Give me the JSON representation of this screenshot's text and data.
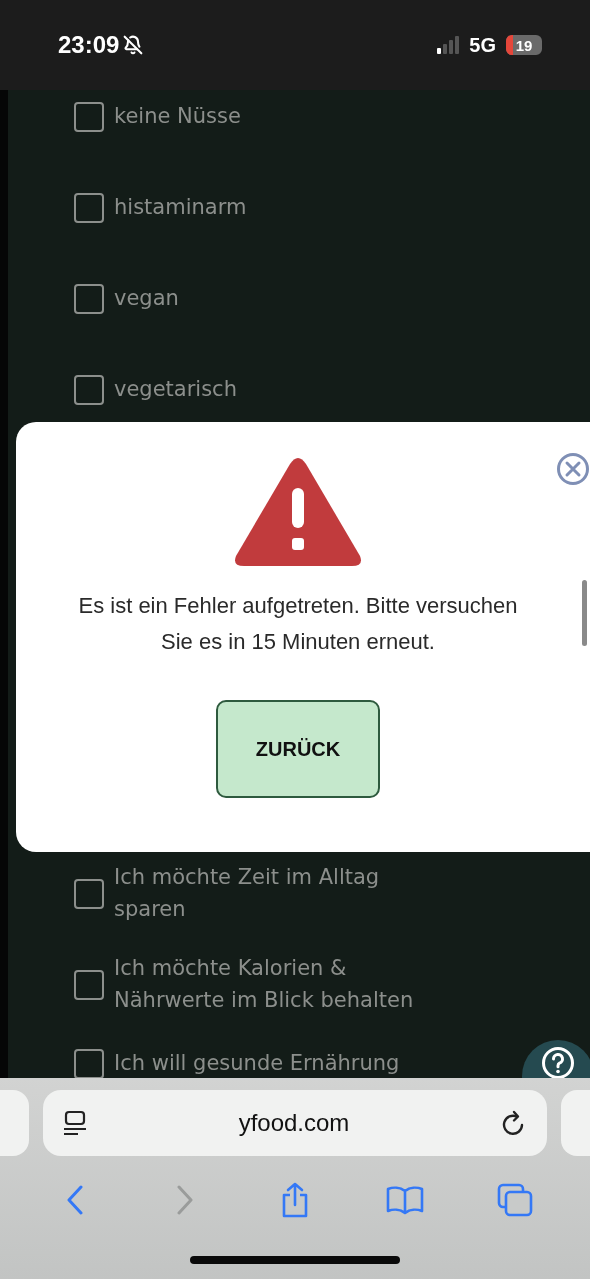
{
  "status_bar": {
    "time": "23:09",
    "silent": true,
    "network": "5G",
    "battery": "19"
  },
  "options_top": [
    {
      "label": "keine Nüsse",
      "checked": false
    },
    {
      "label": "histaminarm",
      "checked": false
    },
    {
      "label": "vegan",
      "checked": false
    },
    {
      "label": "vegetarisch",
      "checked": false
    }
  ],
  "options_bottom": [
    {
      "label": "Ich möchte Zeit im Alltag sparen",
      "checked": false
    },
    {
      "label": "Ich möchte Kalorien & Nährwerte im Blick behalten",
      "checked": false
    },
    {
      "label": "Ich will gesunde Ernährung",
      "checked": false
    }
  ],
  "error_dialog": {
    "message": "Es ist ein Fehler aufgetreten. Bitte versuchen Sie es in 15 Minuten erneut.",
    "button": "ZURÜCK"
  },
  "browser": {
    "url": "yfood.com"
  }
}
